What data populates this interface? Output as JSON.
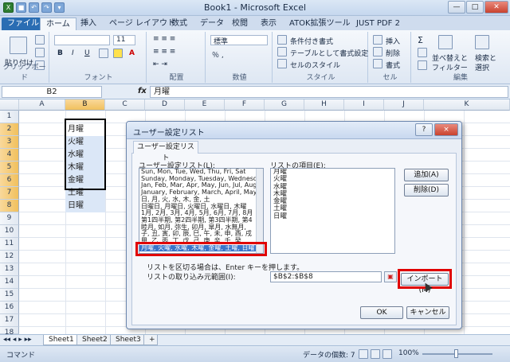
{
  "window": {
    "title": "Book1 - Microsoft Excel"
  },
  "tabs": [
    "ファイル",
    "ホーム",
    "挿入",
    "ページ レイアウト",
    "数式",
    "データ",
    "校閲",
    "表示",
    "ATOK拡張ツール",
    "JUST PDF 2"
  ],
  "ribbon": {
    "clipboard": {
      "label": "クリップボード",
      "paste": "貼り付け"
    },
    "font": {
      "label": "フォント",
      "size": "11"
    },
    "alignment": {
      "label": "配置"
    },
    "number": {
      "label": "数値",
      "format": "標準"
    },
    "styles": {
      "label": "スタイル",
      "cond": "条件付き書式",
      "table": "テーブルとして書式設定",
      "cell": "セルのスタイル"
    },
    "cells": {
      "label": "セル",
      "insert": "挿入",
      "delete": "削除",
      "format": "書式"
    },
    "editing": {
      "label": "編集",
      "sort": "並べ替えと",
      "filter": "フィルター",
      "find": "検索と",
      "select": "選択"
    }
  },
  "formula_bar": {
    "name_box": "B2",
    "fx": "fx",
    "value": "月曜"
  },
  "columns": [
    "A",
    "B",
    "C",
    "D",
    "E",
    "F",
    "G",
    "H",
    "I",
    "J",
    "K"
  ],
  "rows": [
    "1",
    "2",
    "3",
    "4",
    "5",
    "6",
    "7",
    "8",
    "9",
    "10",
    "11",
    "12",
    "13",
    "14",
    "15",
    "16",
    "17",
    "18"
  ],
  "cells_b": [
    "月曜",
    "火曜",
    "水曜",
    "木曜",
    "金曜",
    "土曜",
    "日曜"
  ],
  "sheets": [
    "Sheet1",
    "Sheet2",
    "Sheet3"
  ],
  "status": {
    "mode": "コマンド",
    "count": "データの個数: 7",
    "zoom": "100%"
  },
  "dialog": {
    "title": "ユーザー設定リスト",
    "help": "?",
    "close": "×",
    "tab": "ユーザー設定リスト",
    "lists_label": "ユーザー設定リスト(L):",
    "entries_label": "リストの項目(E):",
    "lists": [
      "Sun, Mon, Tue, Wed, Thu, Fri, Sat",
      "Sunday, Monday, Tuesday, Wednesday",
      "Jan, Feb, Mar, Apr, May, Jun, Jul, Aug,",
      "January, February, March, April, May,",
      "日, 月, 火, 水, 木, 金, 土",
      "日曜日, 月曜日, 火曜日, 水曜日, 木曜",
      "1月, 2月, 3月, 4月, 5月, 6月, 7月, 8月",
      "第1四半期, 第2四半期, 第3四半期, 第4",
      "睦月, 如月, 弥生, 卯月, 皐月, 水無月,",
      "子, 丑, 寅, 卯, 辰, 巳, 午, 未, 申, 酉, 戌",
      "甲, 乙, 丙, 丁, 戊, 己, 庚, 辛, 壬, 癸"
    ],
    "selected_list": "月曜, 火曜, 水曜, 木曜, 金曜, 土曜, 日曜",
    "entries": [
      "月曜",
      "火曜",
      "水曜",
      "木曜",
      "金曜",
      "土曜",
      "日曜"
    ],
    "add": "追加(A)",
    "delete": "削除(D)",
    "hint": "リストを区切る場合は、Enter キーを押します。",
    "import_label": "リストの取り込み元範囲(I):",
    "import_range": "$B$2:$B$8",
    "import_btn": "インポート(M)",
    "ok": "OK",
    "cancel": "キャンセル"
  }
}
